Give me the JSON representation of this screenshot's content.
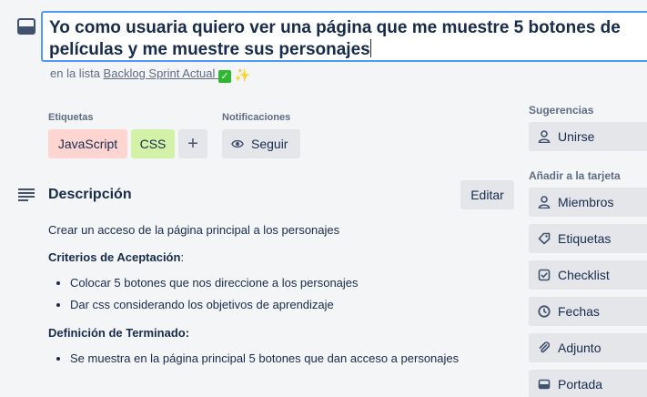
{
  "card": {
    "title": "Yo como usuaria quiero ver una página que me muestre 5 botones de\npelículas y me muestre sus personajes",
    "list_prefix": "en la lista",
    "list_name": "Backlog Sprint Actual"
  },
  "labels": {
    "heading": "Etiquetas",
    "items": [
      "JavaScript",
      "CSS"
    ],
    "add": "+"
  },
  "notifications": {
    "heading": "Notificaciones",
    "follow": "Seguir"
  },
  "description": {
    "heading": "Descripción",
    "edit": "Editar",
    "intro": "Crear un acceso de la página principal a los personajes",
    "criteria_heading": "Criterios de Aceptación",
    "criteria_suffix": ":",
    "criteria": [
      "Colocar 5 botones que nos direccione a los personajes",
      "Dar css considerando los objetivos de aprendizaje"
    ],
    "done_heading": "Definición de Terminado:",
    "done": [
      "Se muestra en la página principal 5 botones que dan acceso a personajes"
    ]
  },
  "sidebar": {
    "suggestions_heading": "Sugerencias",
    "join": "Unirse",
    "add_heading": "Añadir a la tarjeta",
    "items": [
      "Miembros",
      "Etiquetas",
      "Checklist",
      "Fechas",
      "Adjunto",
      "Portada"
    ]
  },
  "colors": {
    "label_js": "#ffd5d2",
    "label_css": "#d3f1a7",
    "focus_border": "#4c9aff"
  }
}
